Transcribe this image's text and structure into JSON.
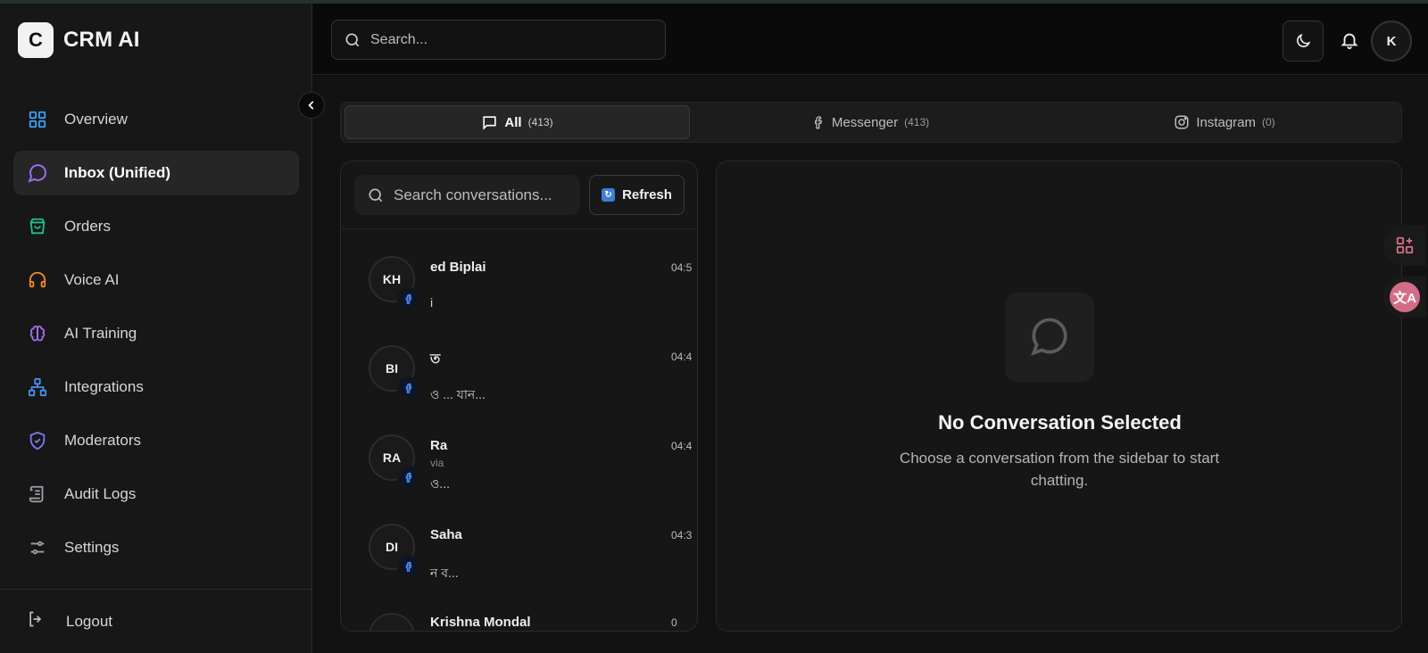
{
  "app": {
    "logo_letter": "C",
    "name": "CRM AI"
  },
  "sidebar": {
    "items": [
      {
        "label": "Overview",
        "icon": "grid-icon",
        "color": "#3b9ff5"
      },
      {
        "label": "Inbox (Unified)",
        "icon": "chat-bubble-icon",
        "color": "#9b6cf5",
        "active": true
      },
      {
        "label": "Orders",
        "icon": "shopping-bag-icon",
        "color": "#21c08b"
      },
      {
        "label": "Voice AI",
        "icon": "headphones-icon",
        "color": "#f28a2b"
      },
      {
        "label": "AI Training",
        "icon": "brain-icon",
        "color": "#a06cf5"
      },
      {
        "label": "Integrations",
        "icon": "network-icon",
        "color": "#4a8ff0"
      },
      {
        "label": "Moderators",
        "icon": "shield-check-icon",
        "color": "#7a78f0"
      },
      {
        "label": "Audit Logs",
        "icon": "scroll-icon",
        "color": "#9aa0aa"
      },
      {
        "label": "Settings",
        "icon": "sliders-icon",
        "color": "#9aa0aa"
      }
    ],
    "logout_label": "Logout"
  },
  "header": {
    "search_placeholder": "Search...",
    "avatar_initial": "K"
  },
  "tabs": [
    {
      "label": "All",
      "count": "(413)",
      "icon": "message-square-icon",
      "active": true
    },
    {
      "label": "Messenger",
      "count": "(413)",
      "icon": "facebook-icon"
    },
    {
      "label": "Instagram",
      "count": "(0)",
      "icon": "instagram-icon"
    }
  ],
  "conversations": {
    "search_placeholder": "Search conversations...",
    "refresh_label": "Refresh",
    "items": [
      {
        "initials": "KH",
        "name": "ed Biplai",
        "via": "",
        "preview": "i",
        "time": "04:5"
      },
      {
        "initials": "BI",
        "name": "ত",
        "via": "",
        "preview": "ও ... যান...",
        "time": "04:4"
      },
      {
        "initials": "RA",
        "name": "Ra",
        "via": "via",
        "preview": "ও...",
        "time": "04:4"
      },
      {
        "initials": "DI",
        "name": "Saha",
        "via": "",
        "preview": "ন ব...",
        "time": "04:3"
      },
      {
        "initials": "",
        "name": "Krishna Mondal",
        "via": "",
        "preview": "",
        "time": "0"
      }
    ]
  },
  "chat": {
    "empty_title": "No Conversation Selected",
    "empty_subtitle": "Choose a conversation from the sidebar to start chatting."
  }
}
